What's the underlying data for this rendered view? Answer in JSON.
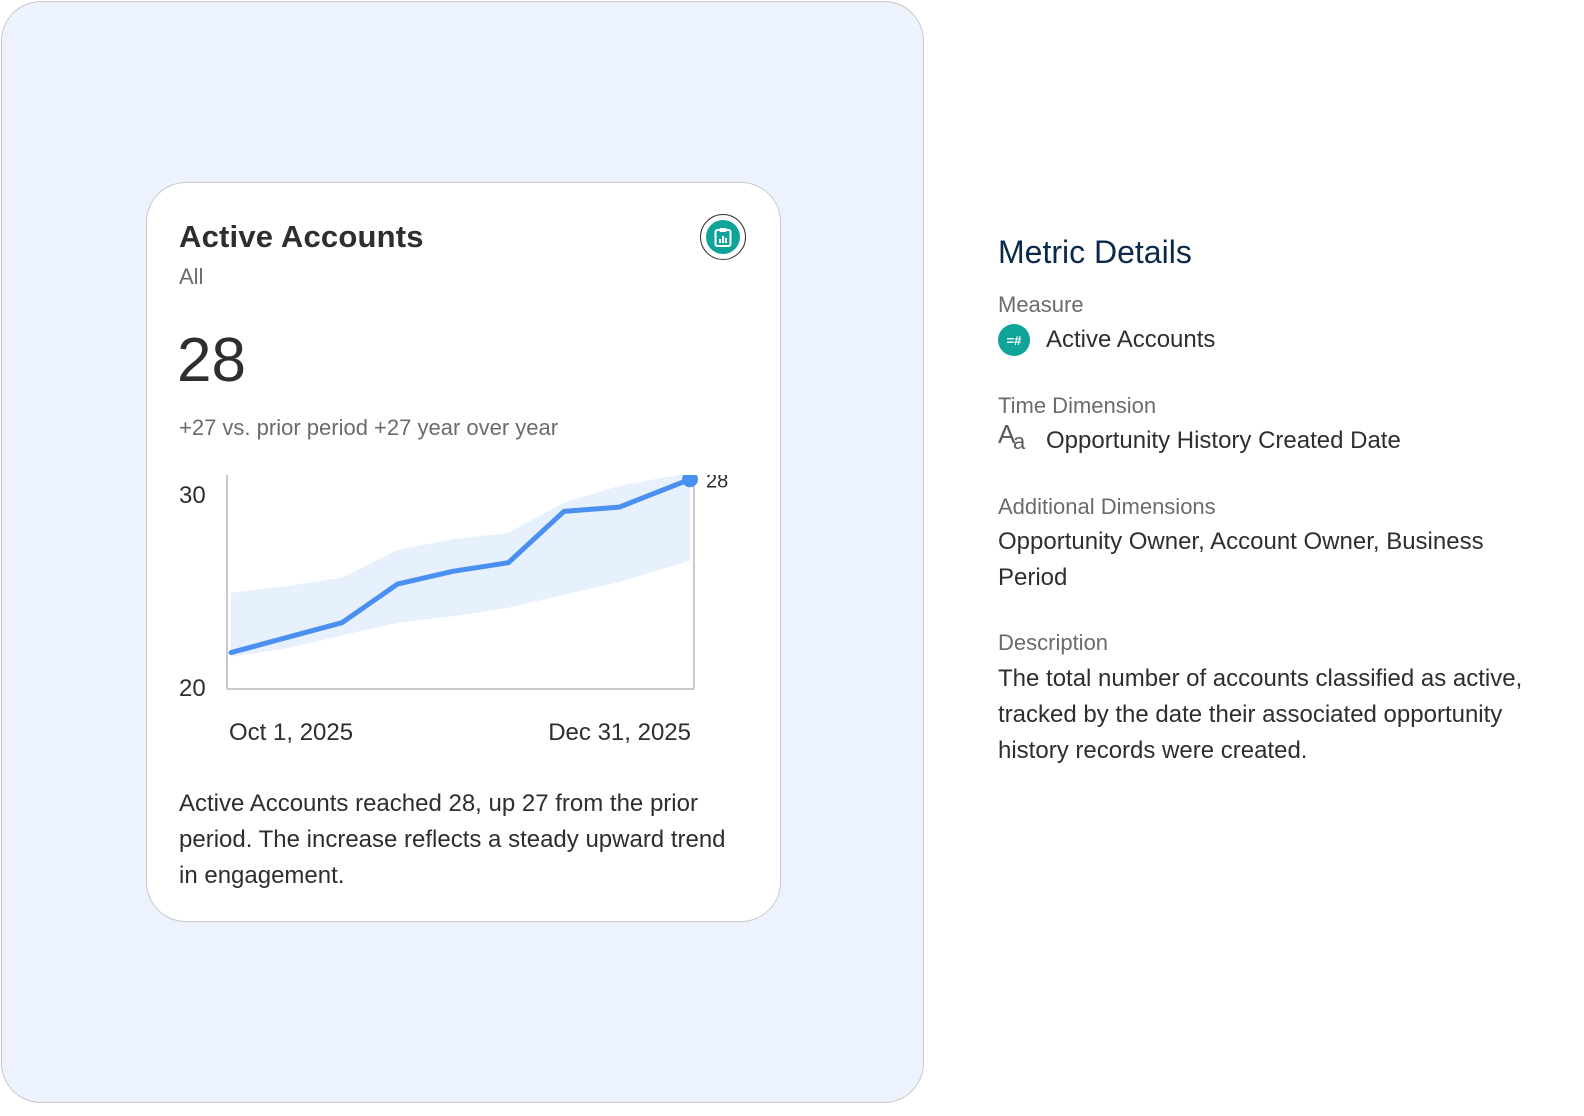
{
  "card": {
    "title": "Active Accounts",
    "subtitle": "All",
    "value": "28",
    "change_text": "+27 vs. prior period +27 year over year",
    "summary": "Active Accounts reached 28, up 27 from the prior period. The increase reflects a steady upward trend in engagement.",
    "icon": "clipboard-chart-icon",
    "accent_color": "#0fa39a"
  },
  "chart_data": {
    "type": "line",
    "x_labels": [
      "Oct 1, 2025",
      "Dec 31, 2025"
    ],
    "x": [
      "2025-10-01",
      "2025-10-12",
      "2025-10-23",
      "2025-11-03",
      "2025-11-14",
      "2025-11-25",
      "2025-12-06",
      "2025-12-17",
      "2025-12-31"
    ],
    "series": [
      {
        "values": [
          21.7,
          22.4,
          23.1,
          24.9,
          25.5,
          25.9,
          28.3,
          28.5,
          29.8
        ],
        "color": "#4a90f0"
      }
    ],
    "band": {
      "upper": [
        24.5,
        24.8,
        25.2,
        26.5,
        27.0,
        27.3,
        28.7,
        29.5,
        30.1
      ],
      "lower": [
        21.5,
        21.9,
        22.5,
        23.1,
        23.4,
        23.8,
        24.4,
        25.0,
        26.0
      ],
      "color": "#e7f0fd"
    },
    "end_label": "28",
    "y_ticks": [
      "30",
      "20"
    ],
    "ylim": [
      20,
      30
    ],
    "grid": false
  },
  "details": {
    "title": "Metric Details",
    "measure_label": "Measure",
    "measure_value": "Active Accounts",
    "measure_icon": "number-field-icon",
    "measure_icon_text": "=#",
    "time_label": "Time Dimension",
    "time_value": "Opportunity History Created Date",
    "time_icon": "text-field-icon",
    "time_icon_big": "A",
    "time_icon_small": "a",
    "additional_label": "Additional Dimensions",
    "additional_value": "Opportunity Owner, Account Owner, Business Period",
    "description_label": "Description",
    "description_value": "The total number of accounts classified as active, tracked by the date their associated opportunity history records were created."
  }
}
